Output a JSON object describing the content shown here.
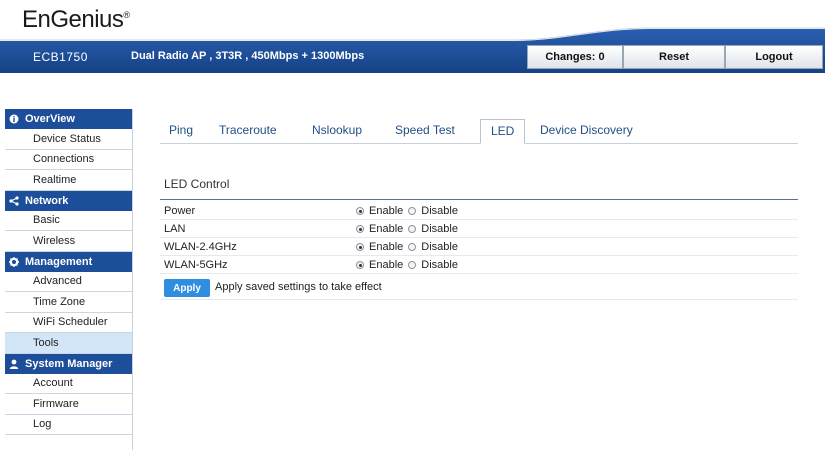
{
  "brand": {
    "logo_text": "EnGenius",
    "logo_mark": "®"
  },
  "header": {
    "model": "ECB1750",
    "description": "Dual Radio AP , 3T3R , 450Mbps + 1300Mbps",
    "changes_label": "Changes: 0",
    "reset_label": "Reset",
    "logout_label": "Logout"
  },
  "sidebar": {
    "groups": [
      {
        "title": "OverView",
        "icon": "info-icon",
        "items": [
          "Device Status",
          "Connections",
          "Realtime"
        ]
      },
      {
        "title": "Network",
        "icon": "share-icon",
        "items": [
          "Basic",
          "Wireless"
        ]
      },
      {
        "title": "Management",
        "icon": "gear-icon",
        "items": [
          "Advanced",
          "Time Zone",
          "WiFi Scheduler",
          "Tools"
        ]
      },
      {
        "title": "System Manager",
        "icon": "user-icon",
        "items": [
          "Account",
          "Firmware",
          "Log"
        ]
      }
    ],
    "active_item": "Tools"
  },
  "tabs": [
    "Ping",
    "Traceroute",
    "Nslookup",
    "Speed Test",
    "LED",
    "Device Discovery"
  ],
  "active_tab": "LED",
  "led_control": {
    "title": "LED Control",
    "rows": [
      {
        "label": "Power",
        "enable": "Enable",
        "disable": "Disable",
        "selected": "Enable"
      },
      {
        "label": "LAN",
        "enable": "Enable",
        "disable": "Disable",
        "selected": "Enable"
      },
      {
        "label": "WLAN-2.4GHz",
        "enable": "Enable",
        "disable": "Disable",
        "selected": "Enable"
      },
      {
        "label": "WLAN-5GHz",
        "enable": "Enable",
        "disable": "Disable",
        "selected": "Enable"
      }
    ],
    "apply_label": "Apply",
    "apply_note": "Apply saved settings to take effect"
  },
  "colors": {
    "brand_blue": "#1d4e9a",
    "active_item": "#d3e6f7",
    "apply_button": "#2f8ee0"
  }
}
